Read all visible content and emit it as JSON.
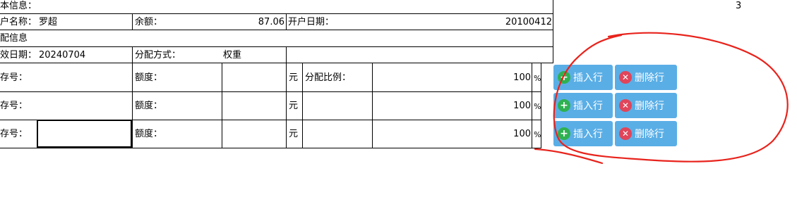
{
  "page_number": "3",
  "basic_info": {
    "section_label": "本信息：",
    "account_name_label": "户名称：",
    "account_name_value": "罗超",
    "balance_label": "余额：",
    "balance_value": "87.06",
    "open_date_label": "开户日期：",
    "open_date_value": "20100412"
  },
  "allocation_info": {
    "section_label": "配信息",
    "effective_date_label": "效日期：",
    "effective_date_value": "20240704",
    "method_label": "分配方式：",
    "method_value": "权重"
  },
  "rows": [
    {
      "account_label": "存号：",
      "quota_label": "额度：",
      "unit": "元",
      "ratio_label": "分配比例：",
      "ratio_value": "100",
      "percent": "%"
    },
    {
      "account_label": "存号：",
      "quota_label": "额度：",
      "unit": "元",
      "ratio_label": "",
      "ratio_value": "100",
      "percent": "%"
    },
    {
      "account_label": "存号：",
      "quota_label": "额度：",
      "unit": "元",
      "ratio_label": "",
      "ratio_value": "100",
      "percent": "%"
    }
  ],
  "buttons": {
    "insert_label": "插入行",
    "delete_label": "删除行"
  },
  "colors": {
    "button_bg": "#5aaee6",
    "insert_icon": "#2fb151",
    "delete_icon": "#e0455a",
    "annotation": "#e8231c"
  },
  "icons": [
    "plus-icon",
    "close-icon"
  ]
}
